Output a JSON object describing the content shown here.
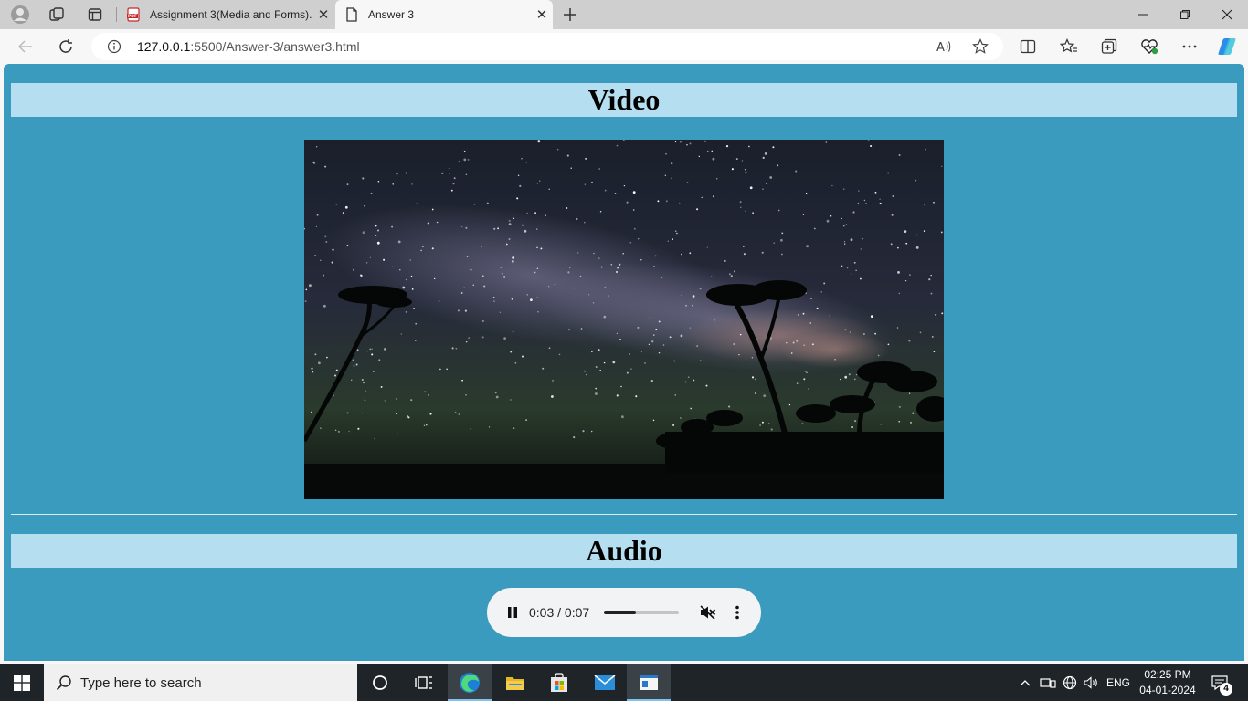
{
  "browser": {
    "tabs": [
      {
        "label": "Assignment 3(Media and Forms).",
        "favicon": "pdf-icon"
      },
      {
        "label": "Answer 3",
        "favicon": "page-icon"
      }
    ],
    "address": {
      "host": "127.0.0.1",
      "path": ":5500/Answer-3/answer3.html"
    }
  },
  "page": {
    "video_heading": "Video",
    "audio_heading": "Audio",
    "audio_player": {
      "time": "0:03 / 0:07",
      "progress": 0.43
    },
    "colors": {
      "background": "#3a9bbf",
      "heading_band": "#b5dff0"
    }
  },
  "taskbar": {
    "search_placeholder": "Type here to search",
    "language": "ENG",
    "time": "02:25 PM",
    "date": "04-01-2024",
    "notification_count": "4"
  }
}
